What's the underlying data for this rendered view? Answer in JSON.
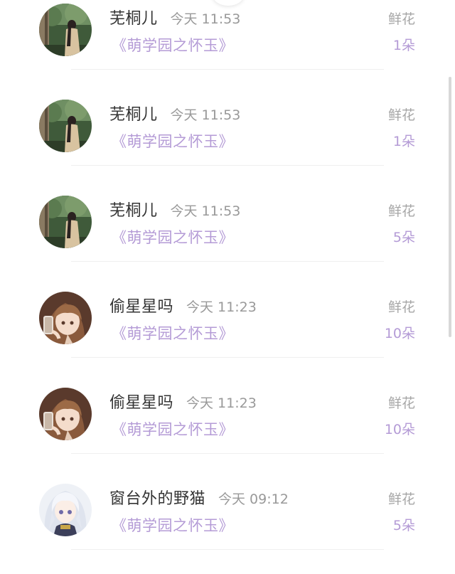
{
  "gifts": [
    {
      "user": "芜桐儿",
      "time": "今天 11:53",
      "book": "《萌学园之怀玉》",
      "gift_type": "鲜花",
      "count": "1朵",
      "avatar": "forest-girl-avatar"
    },
    {
      "user": "芜桐儿",
      "time": "今天 11:53",
      "book": "《萌学园之怀玉》",
      "gift_type": "鲜花",
      "count": "1朵",
      "avatar": "forest-girl-avatar"
    },
    {
      "user": "芜桐儿",
      "time": "今天 11:53",
      "book": "《萌学园之怀玉》",
      "gift_type": "鲜花",
      "count": "5朵",
      "avatar": "forest-girl-avatar"
    },
    {
      "user": "偷星星吗",
      "time": "今天 11:23",
      "book": "《萌学园之怀玉》",
      "gift_type": "鲜花",
      "count": "10朵",
      "avatar": "anime-girl-phone-avatar"
    },
    {
      "user": "偷星星吗",
      "time": "今天 11:23",
      "book": "《萌学园之怀玉》",
      "gift_type": "鲜花",
      "count": "10朵",
      "avatar": "anime-girl-phone-avatar"
    },
    {
      "user": "窗台外的野猫",
      "time": "今天 09:12",
      "book": "《萌学园之怀玉》",
      "gift_type": "鲜花",
      "count": "5朵",
      "avatar": "white-hair-anime-avatar"
    }
  ]
}
